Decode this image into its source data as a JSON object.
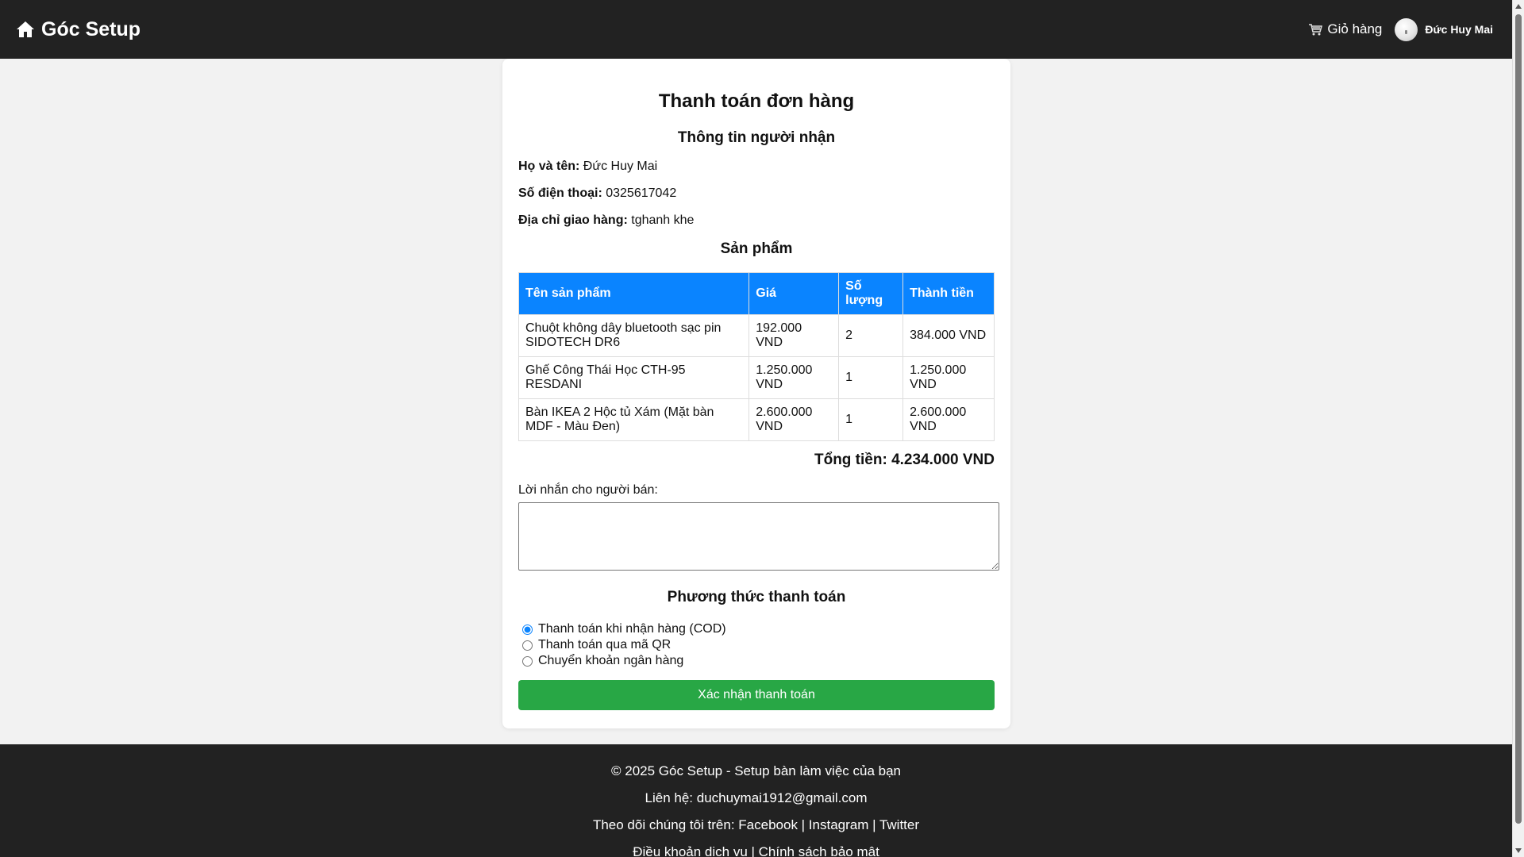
{
  "header": {
    "brand": "Góc Setup",
    "cart_label": "Giỏ hàng",
    "user_name": "Đức Huy Mai"
  },
  "checkout": {
    "title": "Thanh toán đơn hàng",
    "recipient_heading": "Thông tin người nhận",
    "name_label": "Họ và tên:",
    "name_value": "Đức Huy Mai",
    "phone_label": "Số điện thoại:",
    "phone_value": "0325617042",
    "address_label": "Địa chỉ giao hàng:",
    "address_value": "tghanh khe",
    "products_heading": "Sản phẩm",
    "table": {
      "headers": [
        "Tên sản phẩm",
        "Giá",
        "Số lượng",
        "Thành tiền"
      ],
      "rows": [
        [
          "Chuột không dây bluetooth sạc pin SIDOTECH DR6",
          "192.000 VND",
          "2",
          "384.000 VND"
        ],
        [
          "Ghế Công Thái Học CTH-95 RESDANI",
          "1.250.000 VND",
          "1",
          "1.250.000 VND"
        ],
        [
          "Bàn IKEA 2 Hộc tủ Xám (Mặt bàn MDF - Màu Đen)",
          "2.600.000 VND",
          "1",
          "2.600.000 VND"
        ]
      ]
    },
    "total": "Tổng tiền: 4.234.000 VND",
    "message_label": "Lời nhắn cho người bán:",
    "message_value": "",
    "payment_heading": "Phương thức thanh toán",
    "payment_options": [
      {
        "label": "Thanh toán khi nhận hàng (COD)",
        "selected": true
      },
      {
        "label": "Thanh toán qua mã QR",
        "selected": false
      },
      {
        "label": "Chuyển khoản ngân hàng",
        "selected": false
      }
    ],
    "confirm_label": "Xác nhận thanh toán"
  },
  "footer": {
    "copyright": "© 2025 Góc Setup - Setup bàn làm việc của bạn",
    "contact": "Liên hệ: duchuymai1912@gmail.com",
    "follow": "Theo dõi chúng tôi trên: Facebook | Instagram | Twitter",
    "terms": "Điều khoản dịch vụ | Chính sách bảo mật"
  },
  "colors": {
    "header_bg": "#222222",
    "table_header_bg": "#0a84ff",
    "confirm_bg": "#28a745",
    "page_bg": "#f2f2f2"
  }
}
